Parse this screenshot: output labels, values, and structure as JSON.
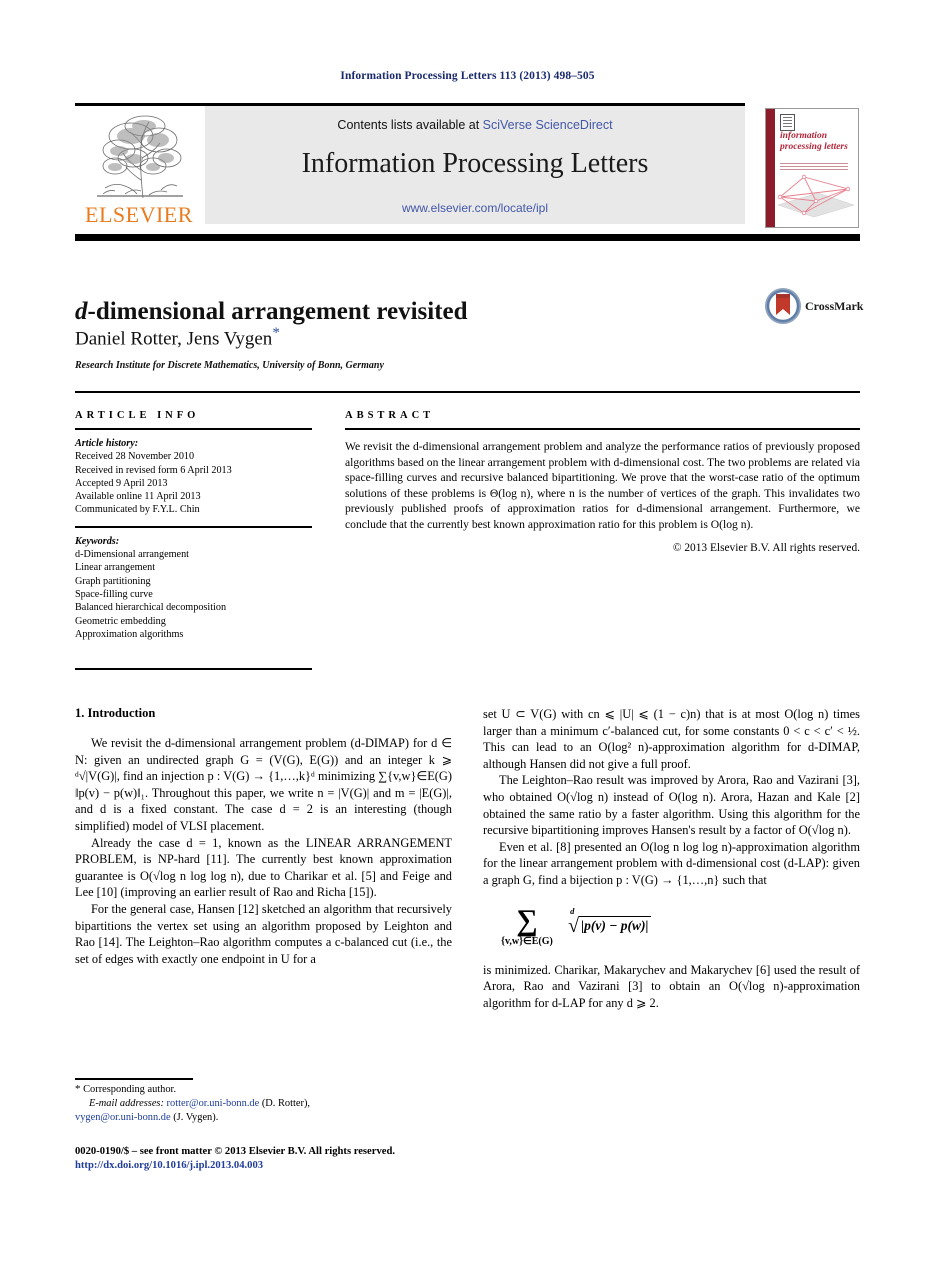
{
  "running_head": "Information Processing Letters 113 (2013) 498–505",
  "masthead": {
    "contents_prefix": "Contents lists available at ",
    "contents_link": "SciVerse ScienceDirect",
    "journal_title": "Information Processing Letters",
    "journal_url": "www.elsevier.com/locate/ipl",
    "publisher_word": "ELSEVIER",
    "cover_title": "information processing letters"
  },
  "crossmark": {
    "label": "CrossMark"
  },
  "article": {
    "title_italic": "d",
    "title_rest": "-dimensional arrangement revisited",
    "authors": "Daniel Rotter, Jens Vygen",
    "author_marker": "*",
    "affiliation": "Research Institute for Discrete Mathematics, University of Bonn, Germany"
  },
  "info": {
    "heading": "ARTICLE INFO",
    "history_label": "Article history:",
    "history": [
      "Received 28 November 2010",
      "Received in revised form 6 April 2013",
      "Accepted 9 April 2013",
      "Available online 11 April 2013",
      "Communicated by F.Y.L. Chin"
    ],
    "keywords_label": "Keywords:",
    "keywords": [
      "d-Dimensional arrangement",
      "Linear arrangement",
      "Graph partitioning",
      "Space-filling curve",
      "Balanced hierarchical decomposition",
      "Geometric embedding",
      "Approximation algorithms"
    ]
  },
  "abstract": {
    "heading": "ABSTRACT",
    "text": "We revisit the d-dimensional arrangement problem and analyze the performance ratios of previously proposed algorithms based on the linear arrangement problem with d-dimensional cost. The two problems are related via space-filling curves and recursive balanced bipartitioning. We prove that the worst-case ratio of the optimum solutions of these problems is Θ(log n), where n is the number of vertices of the graph. This invalidates two previously published proofs of approximation ratios for d-dimensional arrangement. Furthermore, we conclude that the currently best known approximation ratio for this problem is O(log n).",
    "copyright": "© 2013 Elsevier B.V. All rights reserved."
  },
  "body": {
    "section_number_title": "1. Introduction",
    "left_paragraphs": [
      "We revisit the d-dimensional arrangement problem (d-DIMAP) for d ∈ N: given an undirected graph G = (V(G), E(G)) and an integer k ⩾ ᵈ√|V(G)|, find an injection p : V(G) → {1,…,k}ᵈ minimizing ∑{v,w}∈E(G) ‖p(v) − p(w)‖₁. Throughout this paper, we write n = |V(G)| and m = |E(G)|, and d is a fixed constant. The case d = 2 is an interesting (though simplified) model of VLSI placement.",
      "Already the case d = 1, known as the LINEAR ARRANGEMENT PROBLEM, is NP-hard [11]. The currently best known approximation guarantee is O(√log n log log n), due to Charikar et al. [5] and Feige and Lee [10] (improving an earlier result of Rao and Richa [15]).",
      "For the general case, Hansen [12] sketched an algorithm that recursively bipartitions the vertex set using an algorithm proposed by Leighton and Rao [14]. The Leighton–Rao algorithm computes a c-balanced cut (i.e., the set of edges with exactly one endpoint in U for a"
    ],
    "right_paragraphs": [
      "set U ⊂ V(G) with cn ⩽ |U| ⩽ (1 − c)n) that is at most O(log n) times larger than a minimum c′-balanced cut, for some constants 0 < c < c′ < ½. This can lead to an O(log² n)-approximation algorithm for d-DIMAP, although Hansen did not give a full proof.",
      "The Leighton–Rao result was improved by Arora, Rao and Vazirani [3], who obtained O(√log n) instead of O(log n). Arora, Hazan and Kale [2] obtained the same ratio by a faster algorithm. Using this algorithm for the recursive bipartitioning improves Hansen's result by a factor of O(√log n).",
      "Even et al. [8] presented an O(log n log log n)-approximation algorithm for the linear arrangement problem with d-dimensional cost (d-LAP): given a graph G, find a bijection p : V(G) → {1,…,n} such that",
      "is minimized. Charikar, Makarychev and Makarychev [6] used the result of Arora, Rao and Vazirani [3] to obtain an O(√log n)-approximation algorithm for d-LAP for any d ⩾ 2."
    ],
    "equation": {
      "sum_symbol": "∑",
      "sum_subscript": "{v,w}∈E(G)",
      "root_index": "d",
      "radicand": "|p(v) − p(w)|"
    }
  },
  "footnote": {
    "star": "*",
    "corresponding": "Corresponding author.",
    "email_label": "E-mail addresses:",
    "email1": "rotter@or.uni-bonn.de",
    "email1_owner": "(D. Rotter),",
    "email2": "vygen@or.uni-bonn.de",
    "email2_owner": "(J. Vygen)."
  },
  "imprint": {
    "line1": "0020-0190/$ – see front matter © 2013 Elsevier B.V. All rights reserved.",
    "doi": "http://dx.doi.org/10.1016/j.ipl.2013.04.003"
  },
  "colors": {
    "running_head": "#1a2a6c",
    "link_blue": "#4257a8",
    "reference_blue": "#1f3d99",
    "elsevier_orange": "#e87b1e",
    "banner_gray": "#e9e9e9",
    "cover_red": "#8d1c2a"
  }
}
